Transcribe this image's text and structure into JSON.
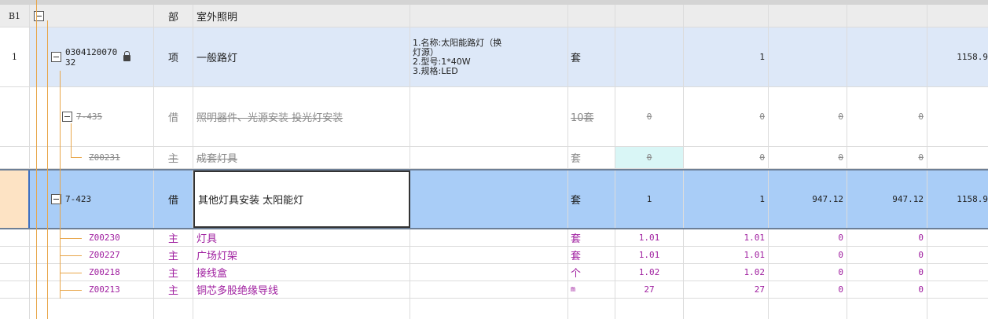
{
  "rows": {
    "section": {
      "index": "B1",
      "type": "部",
      "name": "室外照明"
    },
    "item1": {
      "index": "1",
      "code_line1": "0304120070",
      "code_line2": "32",
      "type": "项",
      "name": "一般路灯",
      "features": [
        "1.名称:太阳能路灯（换",
        "灯源）",
        "2.型号:1*40W",
        "3.规格:LED"
      ],
      "unit": "套",
      "qty2": "1",
      "total": "1158.9"
    },
    "q435": {
      "code": "7-435",
      "type": "借",
      "name": "照明器件、光源安装 投光灯安装",
      "unit": "10套",
      "q1": "0",
      "q2": "0",
      "p1": "0",
      "p2": "0"
    },
    "z231": {
      "code": "Z00231",
      "type": "主",
      "name": "成套灯具",
      "unit": "套",
      "q1": "0",
      "q2": "0",
      "p1": "0",
      "p2": "0"
    },
    "q423": {
      "code": "7-423",
      "type": "借",
      "name": "其他灯具安装 太阳能灯",
      "unit": "套",
      "q1": "1",
      "q2": "1",
      "p1": "947.12",
      "p2": "947.12",
      "total": "1158.9"
    },
    "materials": [
      {
        "code": "Z00230",
        "type": "主",
        "name": "灯具",
        "unit": "套",
        "q1": "1.01",
        "q2": "1.01",
        "p1": "0",
        "p2": "0"
      },
      {
        "code": "Z00227",
        "type": "主",
        "name": "广场灯架",
        "unit": "套",
        "q1": "1.01",
        "q2": "1.01",
        "p1": "0",
        "p2": "0"
      },
      {
        "code": "Z00218",
        "type": "主",
        "name": "接线盒",
        "unit": "个",
        "q1": "1.02",
        "q2": "1.02",
        "p1": "0",
        "p2": "0"
      },
      {
        "code": "Z00213",
        "type": "主",
        "name": "铜芯多股绝缘导线",
        "unit": "m",
        "q1": "27",
        "q2": "27",
        "p1": "0",
        "p2": "0"
      }
    ]
  },
  "colors": {
    "selected_row": "#a9cdf7",
    "item_row": "#dde8f8",
    "material_text": "#a020a0",
    "tree_line": "#e8a64a"
  },
  "icons": {
    "expander": "collapse-minus-icon",
    "lock": "lock-icon"
  }
}
